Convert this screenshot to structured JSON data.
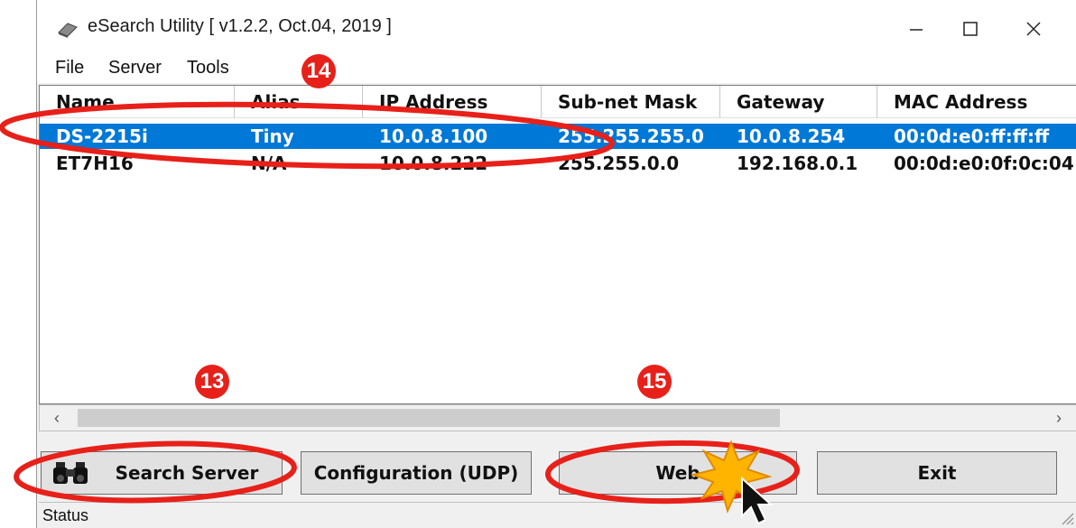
{
  "window": {
    "title": "eSearch Utility [ v1.2.2, Oct.04, 2019 ]"
  },
  "menu": [
    "File",
    "Server",
    "Tools"
  ],
  "table": {
    "columns": [
      "Name",
      "Alias",
      "IP Address",
      "Sub-net Mask",
      "Gateway",
      "MAC Address"
    ],
    "rows": [
      {
        "cells": [
          "DS-2215i",
          "Tiny",
          "10.0.8.100",
          "255.255.255.0",
          "10.0.8.254",
          "00:0d:e0:ff:ff:ff"
        ],
        "selected": true
      },
      {
        "cells": [
          "ET7H16",
          "N/A",
          "10.0.8.222",
          "255.255.0.0",
          "192.168.0.1",
          "00:0d:e0:0f:0c:04"
        ],
        "selected": false
      }
    ]
  },
  "buttons": {
    "search_server": "Search Server",
    "configuration": "Configuration (UDP)",
    "web": "Web",
    "exit": "Exit"
  },
  "status": {
    "label": "Status"
  },
  "annotations": {
    "step_13": "13",
    "step_14": "14",
    "step_15": "15"
  },
  "colors": {
    "selection": "#0078d7",
    "annotation": "#e8201a"
  },
  "icons": [
    "app-icon",
    "minimize-icon",
    "maximize-icon",
    "close-icon",
    "binoculars-icon",
    "scroll-left-icon",
    "scroll-right-icon",
    "mouse-cursor-icon"
  ]
}
